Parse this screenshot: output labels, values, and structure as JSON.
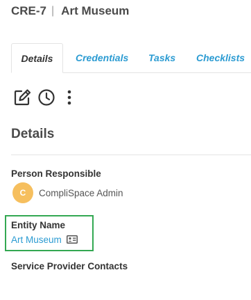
{
  "header": {
    "record_id": "CRE-7",
    "separator": "|",
    "title": "Art Museum"
  },
  "tabs": [
    {
      "label": "Details",
      "active": true
    },
    {
      "label": "Credentials",
      "active": false
    },
    {
      "label": "Tasks",
      "active": false
    },
    {
      "label": "Checklists",
      "active": false
    }
  ],
  "toolbar": {
    "icons": [
      "edit-icon",
      "history-icon",
      "more-vertical-icon"
    ]
  },
  "details": {
    "heading": "Details",
    "person_responsible": {
      "label": "Person Responsible",
      "avatar_initial": "C",
      "name": "CompliSpace Admin"
    },
    "entity_name": {
      "label": "Entity Name",
      "value": "Art Museum",
      "icon": "contact-card-icon"
    },
    "service_provider_contacts": {
      "label": "Service Provider Contacts"
    }
  },
  "colors": {
    "link": "#2b9bd2",
    "avatar": "#f6bf5e",
    "highlight": "#33a852",
    "text": "#333333",
    "divider": "#e3e3e3"
  }
}
